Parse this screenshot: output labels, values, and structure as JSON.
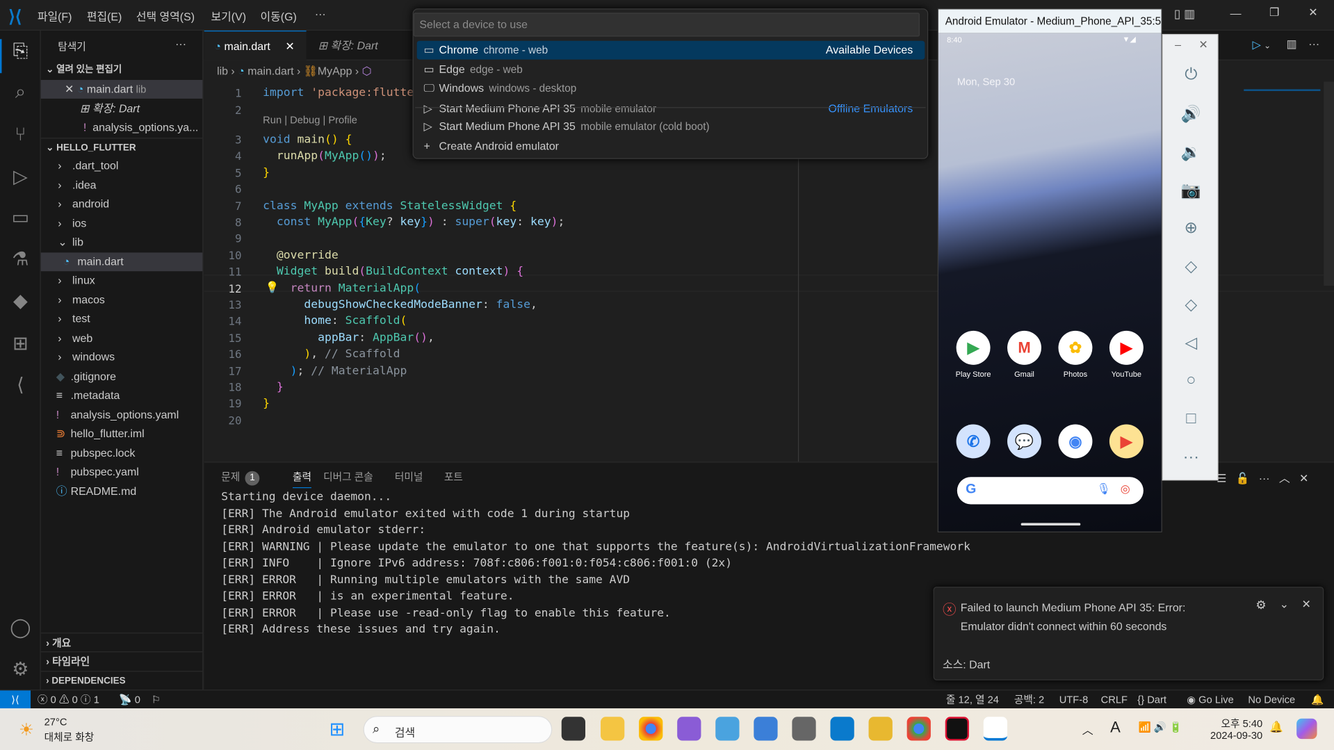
{
  "menu": [
    "파일(F)",
    "편집(E)",
    "선택 영역(S)",
    "보기(V)",
    "이동(G)",
    "···"
  ],
  "sidebar": {
    "title": "탐색기",
    "more": "···",
    "open_editors": "열려 있는 편집기",
    "open_items": [
      {
        "label": "main.dart",
        "desc": "lib"
      },
      {
        "label": "확장: Dart"
      },
      {
        "label": "analysis_options.ya..."
      }
    ],
    "project": "HELLO_FLUTTER",
    "items": [
      {
        "label": ".dart_tool",
        "type": "folder"
      },
      {
        "label": ".idea",
        "type": "folder"
      },
      {
        "label": "android",
        "type": "folder"
      },
      {
        "label": "ios",
        "type": "folder"
      },
      {
        "label": "lib",
        "type": "folder-open"
      },
      {
        "label": "main.dart",
        "type": "dart",
        "indent": true,
        "selected": true
      },
      {
        "label": "linux",
        "type": "folder"
      },
      {
        "label": "macos",
        "type": "folder"
      },
      {
        "label": "test",
        "type": "folder"
      },
      {
        "label": "web",
        "type": "folder"
      },
      {
        "label": "windows",
        "type": "folder"
      },
      {
        "label": ".gitignore",
        "type": "git"
      },
      {
        "label": ".metadata",
        "type": "lines"
      },
      {
        "label": "analysis_options.yaml",
        "type": "yaml"
      },
      {
        "label": "hello_flutter.iml",
        "type": "rss"
      },
      {
        "label": "pubspec.lock",
        "type": "lines"
      },
      {
        "label": "pubspec.yaml",
        "type": "yaml"
      },
      {
        "label": "README.md",
        "type": "info"
      }
    ],
    "bottom": [
      "개요",
      "타임라인",
      "DEPENDENCIES"
    ]
  },
  "tabs": [
    {
      "label": "main.dart",
      "active": true
    },
    {
      "label": "확장: Dart"
    }
  ],
  "breadcrumb": [
    "lib",
    "main.dart",
    "MyApp"
  ],
  "codelens": "Run | Debug | Profile",
  "current_line": 12,
  "code": [
    [
      [
        "import",
        "kw"
      ],
      [
        " "
      ],
      [
        "'package:flutte",
        "st"
      ]
    ],
    [],
    [
      [
        "void",
        "kw"
      ],
      [
        " "
      ],
      [
        "main",
        "fn"
      ],
      [
        "()",
        "b1"
      ],
      [
        " "
      ],
      [
        "{",
        "b1"
      ]
    ],
    [
      [
        "  "
      ],
      [
        "runApp",
        "fn"
      ],
      [
        "(",
        "b2"
      ],
      [
        "MyApp",
        "ty"
      ],
      [
        "()",
        "b3"
      ],
      [
        ")",
        "b2"
      ],
      [
        ";"
      ]
    ],
    [
      [
        "}",
        "b1"
      ]
    ],
    [],
    [
      [
        "class",
        "kw"
      ],
      [
        " "
      ],
      [
        "MyApp",
        "ty"
      ],
      [
        " "
      ],
      [
        "extends",
        "kw"
      ],
      [
        " "
      ],
      [
        "StatelessWidget",
        "ty"
      ],
      [
        " "
      ],
      [
        "{",
        "b1"
      ]
    ],
    [
      [
        "  "
      ],
      [
        "const",
        "kw"
      ],
      [
        " "
      ],
      [
        "MyApp",
        "ty"
      ],
      [
        "(",
        "b2"
      ],
      [
        "{",
        "b3"
      ],
      [
        "Key",
        "ty"
      ],
      [
        "? "
      ],
      [
        "key",
        "va"
      ],
      [
        "}",
        "b3"
      ],
      [
        ")",
        "b2"
      ],
      [
        " : "
      ],
      [
        "super",
        "kw"
      ],
      [
        "(",
        "b2"
      ],
      [
        "key",
        "va"
      ],
      [
        ": "
      ],
      [
        "key",
        "va"
      ],
      [
        ")",
        "b2"
      ],
      [
        ";"
      ]
    ],
    [],
    [
      [
        "  "
      ],
      [
        "@override",
        "fn"
      ]
    ],
    [
      [
        "  "
      ],
      [
        "Widget",
        "ty"
      ],
      [
        " "
      ],
      [
        "build",
        "fn"
      ],
      [
        "(",
        "b2"
      ],
      [
        "BuildContext",
        "ty"
      ],
      [
        " "
      ],
      [
        "context",
        "va"
      ],
      [
        ")",
        "b2"
      ],
      [
        " "
      ],
      [
        "{",
        "b2"
      ]
    ],
    [
      [
        "    "
      ],
      [
        "return",
        "ctl"
      ],
      [
        " "
      ],
      [
        "MaterialApp",
        "ty"
      ],
      [
        "(",
        "b3"
      ]
    ],
    [
      [
        "      "
      ],
      [
        "debugShowCheckedModeBanner",
        "va"
      ],
      [
        ": "
      ],
      [
        "false",
        "kw"
      ],
      [
        ","
      ]
    ],
    [
      [
        "      "
      ],
      [
        "home",
        "va"
      ],
      [
        ": "
      ],
      [
        "Scaffold",
        "ty"
      ],
      [
        "(",
        "b1"
      ]
    ],
    [
      [
        "        "
      ],
      [
        "appBar",
        "va"
      ],
      [
        ": "
      ],
      [
        "AppBar",
        "ty"
      ],
      [
        "()",
        "b2"
      ],
      [
        ","
      ]
    ],
    [
      [
        "      "
      ],
      [
        ")",
        "b1"
      ],
      [
        ", "
      ],
      [
        "// Scaffold",
        "cm"
      ]
    ],
    [
      [
        "    "
      ],
      [
        ")",
        "b3"
      ],
      [
        "; "
      ],
      [
        "// MaterialApp",
        "cm"
      ]
    ],
    [
      [
        "  "
      ],
      [
        "}",
        "b2"
      ]
    ],
    [
      [
        "}",
        "b1"
      ]
    ],
    []
  ],
  "quickpick": {
    "placeholder": "Select a device to use",
    "items": [
      {
        "icon": "browser",
        "label": "Chrome",
        "desc": "chrome - web",
        "right": "Available Devices",
        "selected": true
      },
      {
        "icon": "browser",
        "label": "Edge",
        "desc": "edge - web"
      },
      {
        "icon": "monitor",
        "label": "Windows",
        "desc": "windows - desktop"
      },
      {
        "icon": "play",
        "label": "Start Medium Phone API 35",
        "desc": "mobile emulator",
        "right": "Offline Emulators"
      },
      {
        "icon": "play",
        "label": "Start Medium Phone API 35",
        "desc": "mobile emulator (cold boot)"
      },
      {
        "icon": "plus",
        "label": "Create Android emulator"
      }
    ]
  },
  "panel": {
    "tabs": [
      {
        "label": "문제",
        "badge": "1"
      },
      {
        "label": "출력",
        "active": true
      },
      {
        "label": "디버그 콘솔"
      },
      {
        "label": "터미널"
      },
      {
        "label": "포트"
      }
    ],
    "output": [
      "Starting device daemon...",
      "[ERR] The Android emulator exited with code 1 during startup",
      "[ERR] Android emulator stderr:",
      "[ERR] WARNING | Please update the emulator to one that supports the feature(s): AndroidVirtualizationFramework",
      "[ERR] INFO    | Ignore IPv6 address: 708f:c806:f001:0:f054:c806:f001:0 (2x)",
      "[ERR] ERROR   | Running multiple emulators with the same AVD",
      "[ERR] ERROR   | is an experimental feature.",
      "[ERR] ERROR   | Please use -read-only flag to enable this feature.",
      "[ERR] Address these issues and try again."
    ]
  },
  "emulator": {
    "title": "Android Emulator - Medium_Phone_API_35:5...",
    "time": "8:40",
    "date": "Mon, Sep 30",
    "apps": [
      {
        "label": "Play Store",
        "glyph": "▶",
        "color": "#34a853"
      },
      {
        "label": "Gmail",
        "glyph": "M",
        "color": "#ea4335"
      },
      {
        "label": "Photos",
        "glyph": "✿",
        "color": "#fbbc05"
      },
      {
        "label": "YouTube",
        "glyph": "▶",
        "color": "#ff0000"
      }
    ],
    "dock": [
      {
        "glyph": "✆",
        "color": "#1a73e8",
        "bg": "#d3e3fd"
      },
      {
        "glyph": "💬",
        "color": "#1a73e8",
        "bg": "#d3e3fd"
      },
      {
        "glyph": "◉",
        "color": "#4285f4",
        "bg": "#fff"
      },
      {
        "glyph": "▶",
        "color": "#ea4335",
        "bg": "#fde293"
      }
    ],
    "search_logo": "G"
  },
  "notification": {
    "message": "Failed to launch Medium Phone API 35: Error: Emulator didn't connect within 60 seconds",
    "source": "소스: Dart",
    "color": "#f14c4c"
  },
  "status": {
    "errors": "0",
    "warnings": "0",
    "info": "1",
    "ports": "0",
    "position": "줄 12, 열 24",
    "spaces": "공백: 2",
    "encoding": "UTF-8",
    "eol": "CRLF",
    "language": "Dart",
    "golive": "Go Live",
    "device": "No Device"
  },
  "taskbar": {
    "temp": "27°C",
    "weather": "대체로 화창",
    "search": "검색",
    "time": "오후 5:40",
    "date": "2024-09-30"
  },
  "colors": {
    "accent": "#0078d4",
    "selection": "#04395e",
    "error": "#f14c4c"
  }
}
